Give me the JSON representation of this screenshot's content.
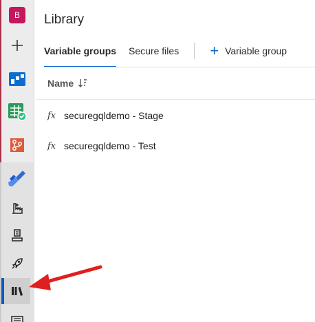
{
  "sidebar": {
    "org_initial": "B",
    "items": [
      {
        "name": "new-project",
        "icon": "plus-icon"
      },
      {
        "name": "boards",
        "icon": "boards-icon",
        "color": "#0078d4"
      },
      {
        "name": "test-plans",
        "icon": "test-plans-icon",
        "color": "#2b9a5c"
      },
      {
        "name": "repos",
        "icon": "repos-icon",
        "color": "#e05b3b"
      },
      {
        "name": "pipelines",
        "icon": "pipelines-icon",
        "color": "#2f6bd8"
      },
      {
        "name": "environments",
        "icon": "environments-icon"
      },
      {
        "name": "releases",
        "icon": "releases-icon"
      },
      {
        "name": "deployments",
        "icon": "rocket-icon"
      },
      {
        "name": "library",
        "icon": "library-icon",
        "selected": true
      },
      {
        "name": "task-groups",
        "icon": "task-groups-icon"
      }
    ]
  },
  "page": {
    "title": "Library"
  },
  "tabs": [
    {
      "label": "Variable groups",
      "active": true
    },
    {
      "label": "Secure files",
      "active": false
    }
  ],
  "add_button": {
    "label": "Variable group"
  },
  "table": {
    "column": "Name",
    "rows": [
      {
        "icon_text": "fx",
        "name": "securegqldemo - Stage"
      },
      {
        "icon_text": "fx",
        "name": "securegqldemo - Test"
      }
    ]
  },
  "colors": {
    "accent": "#0b6acb",
    "annotation_arrow": "#e02020",
    "org_badge": "#c3185d"
  }
}
